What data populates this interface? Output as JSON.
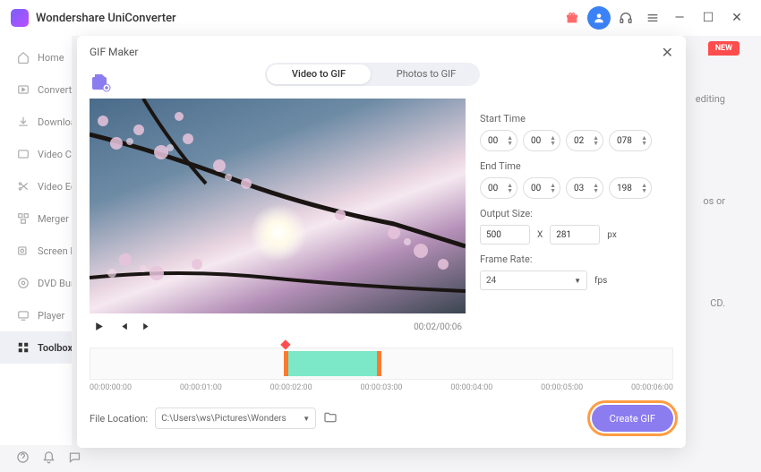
{
  "app_title": "Wondershare UniConverter",
  "sidebar": {
    "items": [
      {
        "label": "Home"
      },
      {
        "label": "Converter"
      },
      {
        "label": "Downloader"
      },
      {
        "label": "Video Compressor"
      },
      {
        "label": "Video Editor"
      },
      {
        "label": "Merger"
      },
      {
        "label": "Screen Recorder"
      },
      {
        "label": "DVD Burner"
      },
      {
        "label": "Player"
      },
      {
        "label": "Toolbox"
      }
    ]
  },
  "badge_new": "NEW",
  "modal": {
    "title": "GIF Maker",
    "tabs": {
      "video": "Video to GIF",
      "photos": "Photos to GIF"
    },
    "time_readout": "00:02/00:06",
    "start_label": "Start Time",
    "end_label": "End Time",
    "start": {
      "h": "00",
      "m": "00",
      "s": "02",
      "ms": "078"
    },
    "end": {
      "h": "00",
      "m": "00",
      "s": "03",
      "ms": "198"
    },
    "output_size_label": "Output Size:",
    "output_w": "500",
    "output_x": "X",
    "output_h": "281",
    "px": "px",
    "frame_rate_label": "Frame Rate:",
    "frame_rate": "24",
    "fps": "fps",
    "timeline": {
      "labels": [
        "00:00:00:00",
        "00:00:01:00",
        "00:00:02:00",
        "00:00:03:00",
        "00:00:04:00",
        "00:00:05:00",
        "00:00:06:00"
      ]
    },
    "file_location_label": "File Location:",
    "file_location": "C:\\Users\\ws\\Pictures\\Wonders",
    "create_btn": "Create GIF"
  },
  "bg": {
    "editing": "editing",
    "os_or": "os or",
    "cd": "CD."
  }
}
